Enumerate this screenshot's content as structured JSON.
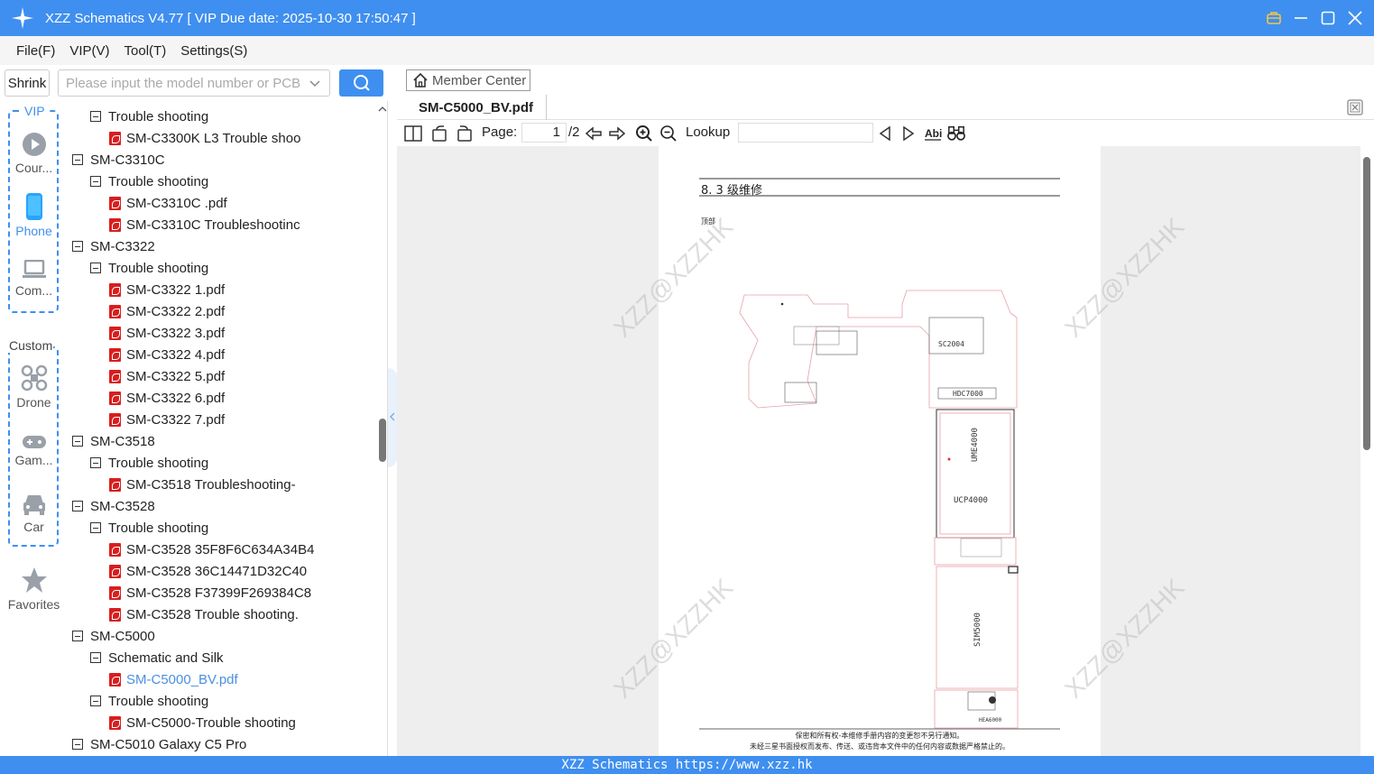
{
  "window": {
    "title": "XZZ Schematics V4.77 [ VIP Due date: 2025-10-30 17:50:47 ]"
  },
  "menu": {
    "items": [
      "File(F)",
      "VIP(V)",
      "Tool(T)",
      "Settings(S)"
    ]
  },
  "toolbar": {
    "shrink_label": "Shrink",
    "search_placeholder": "Please input the model number or PCB"
  },
  "sidebar": {
    "vip_label": "VIP",
    "custom_label": "Custom",
    "items": [
      {
        "label": "Cour...",
        "icon": "play-icon",
        "active": false
      },
      {
        "label": "Phone",
        "icon": "phone-icon",
        "active": true
      },
      {
        "label": "Com...",
        "icon": "laptop-icon",
        "active": false
      },
      {
        "label": "Drone",
        "icon": "drone-icon",
        "active": false
      },
      {
        "label": "Gam...",
        "icon": "gamepad-icon",
        "active": false
      },
      {
        "label": "Car",
        "icon": "car-icon",
        "active": false
      },
      {
        "label": "Favorites",
        "icon": "star-icon",
        "active": false
      }
    ]
  },
  "tree": {
    "nodes": [
      {
        "level": 1,
        "type": "folder",
        "label": "Trouble shooting"
      },
      {
        "level": 2,
        "type": "pdf",
        "label": "SM-C3300K L3 Trouble shoo"
      },
      {
        "level": 0,
        "type": "folder",
        "label": "SM-C3310C"
      },
      {
        "level": 1,
        "type": "folder",
        "label": "Trouble shooting"
      },
      {
        "level": 2,
        "type": "pdf",
        "label": "SM-C3310C .pdf"
      },
      {
        "level": 2,
        "type": "pdf",
        "label": "SM-C3310C Troubleshootinc"
      },
      {
        "level": 0,
        "type": "folder",
        "label": "SM-C3322"
      },
      {
        "level": 1,
        "type": "folder",
        "label": "Trouble shooting"
      },
      {
        "level": 2,
        "type": "pdf",
        "label": "SM-C3322 1.pdf"
      },
      {
        "level": 2,
        "type": "pdf",
        "label": "SM-C3322 2.pdf"
      },
      {
        "level": 2,
        "type": "pdf",
        "label": "SM-C3322 3.pdf"
      },
      {
        "level": 2,
        "type": "pdf",
        "label": "SM-C3322 4.pdf"
      },
      {
        "level": 2,
        "type": "pdf",
        "label": "SM-C3322 5.pdf"
      },
      {
        "level": 2,
        "type": "pdf",
        "label": "SM-C3322 6.pdf"
      },
      {
        "level": 2,
        "type": "pdf",
        "label": "SM-C3322 7.pdf"
      },
      {
        "level": 0,
        "type": "folder",
        "label": "SM-C3518"
      },
      {
        "level": 1,
        "type": "folder",
        "label": "Trouble shooting"
      },
      {
        "level": 2,
        "type": "pdf",
        "label": "SM-C3518 Troubleshooting-"
      },
      {
        "level": 0,
        "type": "folder",
        "label": "SM-C3528"
      },
      {
        "level": 1,
        "type": "folder",
        "label": "Trouble shooting"
      },
      {
        "level": 2,
        "type": "pdf",
        "label": "SM-C3528 35F8F6C634A34B4"
      },
      {
        "level": 2,
        "type": "pdf",
        "label": "SM-C3528 36C14471D32C40"
      },
      {
        "level": 2,
        "type": "pdf",
        "label": "SM-C3528 F37399F269384C8"
      },
      {
        "level": 2,
        "type": "pdf",
        "label": "SM-C3528 Trouble shooting."
      },
      {
        "level": 0,
        "type": "folder",
        "label": "SM-C5000"
      },
      {
        "level": 1,
        "type": "folder",
        "label": "Schematic and Silk"
      },
      {
        "level": 2,
        "type": "pdf",
        "label": "SM-C5000_BV.pdf",
        "selected": true
      },
      {
        "level": 1,
        "type": "folder",
        "label": "Trouble shooting"
      },
      {
        "level": 2,
        "type": "pdf",
        "label": "SM-C5000-Trouble shooting"
      },
      {
        "level": 0,
        "type": "folder",
        "label": "SM-C5010 Galaxy C5 Pro"
      }
    ]
  },
  "viewer": {
    "member_center_label": "Member Center",
    "tab_label": "SM-C5000_BV.pdf",
    "page_label": "Page:",
    "page_current": "1",
    "page_total": "/2",
    "lookup_label": "Lookup",
    "lookup_value": ""
  },
  "document": {
    "section_heading": "8. 3 级维修",
    "sub_heading": "顶部",
    "watermark": "XZZ@XZZHK",
    "components": [
      "SC2004",
      "HDC7000",
      "UME4000",
      "UCP4000",
      "SIM5000",
      "HEA6000"
    ],
    "footer_line1": "保密和所有权-本维修手册内容的变更恕不另行通知。",
    "footer_line2": "未经三星书面授权而发布、传送、或违背本文件中的任何内容或数据严格禁止的。"
  },
  "status": {
    "text": "XZZ Schematics https://www.xzz.hk"
  },
  "colors": {
    "accent": "#3f8ff0",
    "pdf_icon": "#d81e1e",
    "selected_text": "#4a90e2"
  }
}
